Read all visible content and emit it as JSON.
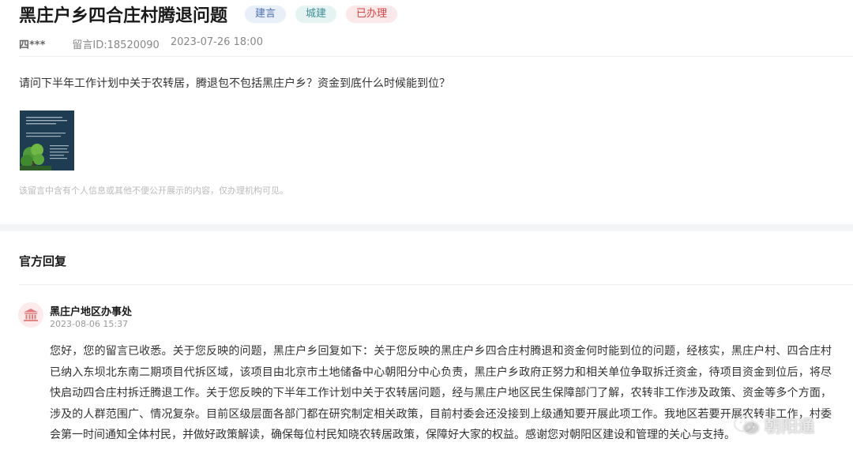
{
  "post": {
    "title": "黑庄户乡四合庄村腾退问题",
    "tags": [
      "建言",
      "城建",
      "已办理"
    ],
    "author": "四***",
    "message_id": "留言ID:18520090",
    "datetime": "2023-07-26 18:00",
    "question": "请问下半年工作计划中关于农转居，腾退包不包括黑庄户乡？资金到底什么时候能到位？",
    "privacy_note": "该留言中含有个人信息或其他不便公开展示的内容，仅办理机构可见。"
  },
  "reply_section": {
    "title": "官方回复",
    "department": "黑庄户地区办事处",
    "date": "2023-08-06 15:37",
    "content": "您好，您的留言已收悉。关于您反映的问题，黑庄户乡回复如下：关于您反映的黑庄户乡四合庄村腾退和资金何时能到位的问题，经核实，黑庄户村、四合庄村已纳入东坝北东南二期项目代拆区域，该项目由北京市土地储备中心朝阳分中心负责，黑庄户乡政府正努力和相关单位争取拆迁资金，待项目资金到位后，将尽快启动四合庄村拆迁腾退工作。关于您反映的下半年工作计划中关于农转居问题，经与黑庄户地区民生保障部门了解，农转非工作涉及政策、资金等多个方面，涉及的人群范围广、情况复杂。目前区级层面各部门都在研究制定相关政策，目前村委会还没接到上级通知要开展此项工作。我地区若要开展农转非工作，村委会第一时间通知全体村民，并做好政策解读，确保每位村民知晓农转居政策，保障好大家的权益。感谢您对朝阳区建设和管理的关心与支持。"
  },
  "watermark": {
    "text": "朝阳通",
    "icon": "wechat-icon"
  },
  "colors": {
    "tag_blue": "#4a72b0",
    "tag_green": "#3c8f96",
    "tag_red": "#d34545",
    "avatar_icon": "#e07b7b"
  }
}
